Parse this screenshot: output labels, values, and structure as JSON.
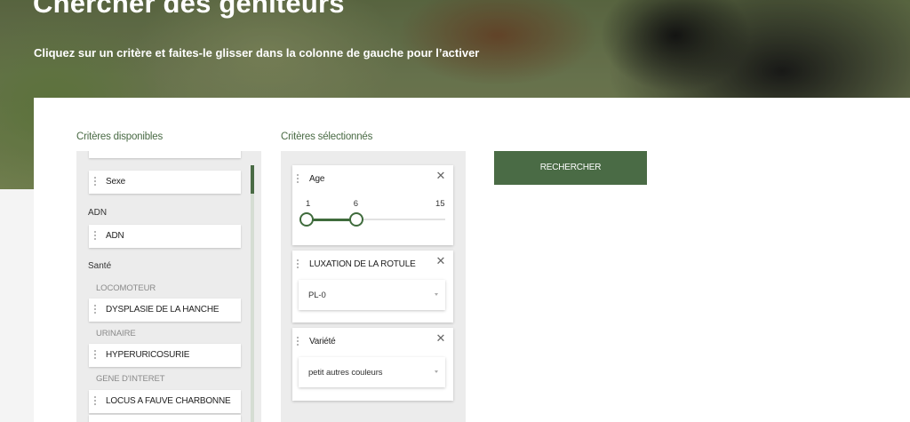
{
  "hero": {
    "title": "Chercher des géniteurs",
    "subtitle": "Cliquez sur un critère et faites-le glisser dans la colonne de gauche pour l’activer"
  },
  "available": {
    "title": "Critères disponibles",
    "items": {
      "sexe": "Sexe",
      "adn_group": "ADN",
      "adn": "ADN",
      "sante_group": "Santé",
      "locomoteur": "LOCOMOTEUR",
      "dysplasie": "DYSPLASIE DE LA HANCHE",
      "urinaire": "URINAIRE",
      "hyperuricosurie": "HYPERURICOSURIE",
      "gene": "GENE D'INTERET",
      "locus": "LOCUS A FAUVE CHARBONNE"
    }
  },
  "selected": {
    "title": "Critères sélectionnés",
    "age": {
      "label": "Age",
      "min": 1,
      "max": 15,
      "low": 1,
      "high": 6,
      "min_text": "1",
      "high_text": "6",
      "max_text": "15"
    },
    "luxation": {
      "label": "LUXATION DE LA ROTULE",
      "value": "PL-0"
    },
    "variete": {
      "label": "Variété",
      "value": "petit autres couleurs"
    }
  },
  "search": {
    "label": "RECHERCHER"
  },
  "colors": {
    "accent": "#4a6b45",
    "slider": "#3f6b3c"
  }
}
